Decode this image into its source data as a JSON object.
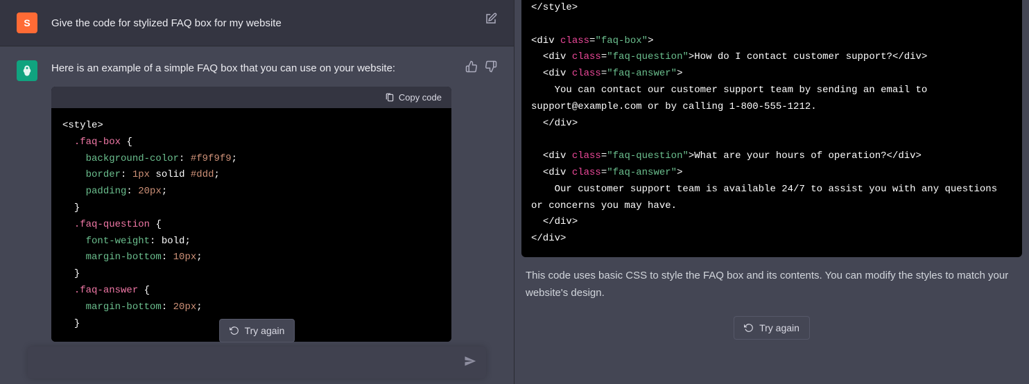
{
  "left": {
    "user_avatar_letter": "S",
    "user_prompt": "Give the code for stylized FAQ box for my website",
    "assistant_intro": "Here is an example of a simple FAQ box that you can use on your website:",
    "copy_label": "Copy code",
    "try_again_label": "Try again",
    "code": {
      "l1_open": "<style>",
      "sel_box": ".faq-box",
      "p_bg": "background-color",
      "v_bg": "#f9f9f9",
      "p_border": "border",
      "v_border_px": "1px",
      "v_border_solid": "solid",
      "v_border_color": "#ddd",
      "p_padding": "padding",
      "v_padding": "20px",
      "sel_q": ".faq-question",
      "p_fw": "font-weight",
      "v_fw": "bold",
      "p_mb": "margin-bottom",
      "v_mb10": "10px",
      "sel_a": ".faq-answer",
      "v_mb20": "20px"
    }
  },
  "right": {
    "code": {
      "close_style": "</style>",
      "div_open": "<div",
      "class_attr": "class",
      "cls_box": "\"faq-box\"",
      "cls_q": "\"faq-question\"",
      "cls_a": "\"faq-answer\"",
      "close_tag": ">",
      "q1_text": "How do I contact customer support?",
      "div_close": "</div>",
      "a1_text_line1": "    You can contact our customer support team by sending an email to",
      "a1_text_line2": "support@example.com or by calling 1-800-555-1212.",
      "q2_text": "What are your hours of operation?",
      "a2_text_line1": "    Our customer support team is available 24/7 to assist you with any questions",
      "a2_text_line2": "or concerns you may have."
    },
    "description": "This code uses basic CSS to style the FAQ box and its contents. You can modify the styles to match your website's design.",
    "try_again_label": "Try again"
  },
  "input_placeholder": ""
}
